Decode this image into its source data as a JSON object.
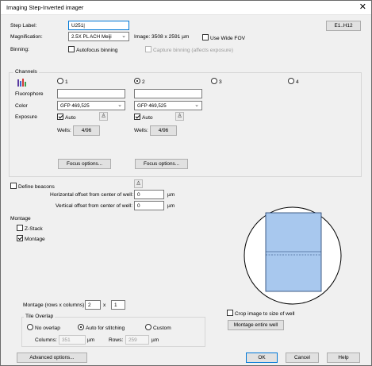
{
  "window": {
    "title": "Imaging Step-Inverted imager",
    "close_glyph": "✕"
  },
  "step": {
    "label": "Step Label:",
    "value": "U251",
    "range_button": "E1..H12"
  },
  "magnification": {
    "label": "Magnification:",
    "value": "2.5X PL ACH Meiji",
    "image_label": "Image: 3508 x 2591 µm",
    "wide_fov": "Use Wide FOV"
  },
  "binning": {
    "label": "Binning:",
    "autofocus": "Autofocus binning",
    "capture": "Capture binning (affects exposure)"
  },
  "channels": {
    "group_label": "Channels",
    "options": [
      "1",
      "2",
      "3",
      "4"
    ],
    "selected": "2",
    "fluorophore_label": "Fluorophore",
    "color_label": "Color",
    "exposure_label": "Exposure",
    "auto_label": "Auto",
    "wells_label": "Wells:",
    "ch1": {
      "color": "GFP 469,525",
      "wells": "4/96",
      "focus": "Focus options..."
    },
    "ch2": {
      "color": "GFP 469,525",
      "wells": "4/96",
      "focus": "Focus options..."
    }
  },
  "beacons": {
    "label": "Define beacons",
    "h_label": "Horizontal offset from center of well:",
    "h_value": "0",
    "v_label": "Vertical offset from center of well:",
    "v_value": "0",
    "unit": "µm"
  },
  "montage": {
    "label": "Montage",
    "zstack": "Z-Stack",
    "montage_cb": "Montage",
    "size_label": "Montage (rows x columns):",
    "rows": "2",
    "x": "x",
    "cols": "1",
    "crop": "Crop image to size of well",
    "entire_well": "Montage entire well"
  },
  "tile": {
    "group_label": "Tile Overlap",
    "no_overlap": "No overlap",
    "auto": "Auto for stitching",
    "custom": "Custom",
    "columns_label": "Columns:",
    "columns_value": "351",
    "rows_label": "Rows:",
    "rows_value": "259",
    "unit": "µm"
  },
  "footer": {
    "advanced": "Advanced options...",
    "ok": "OK",
    "cancel": "Cancel",
    "help": "Help"
  },
  "colors": {
    "tile_fill": "#a8c8ee",
    "tile_border": "#1a3a6a",
    "focus_border": "#0078d7"
  }
}
